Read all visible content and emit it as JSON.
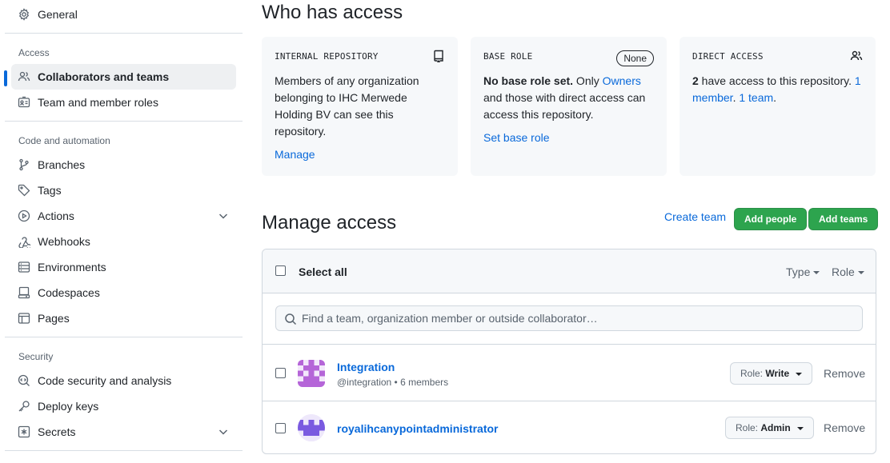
{
  "sidebar": {
    "general": "General",
    "sections": {
      "access": "Access",
      "code_automation": "Code and automation",
      "security": "Security"
    },
    "items": {
      "collaborators": "Collaborators and teams",
      "team_roles": "Team and member roles",
      "branches": "Branches",
      "tags": "Tags",
      "actions": "Actions",
      "webhooks": "Webhooks",
      "environments": "Environments",
      "codespaces": "Codespaces",
      "pages": "Pages",
      "code_security": "Code security and analysis",
      "deploy_keys": "Deploy keys",
      "secrets": "Secrets"
    }
  },
  "who_has_access": {
    "title": "Who has access",
    "internal": {
      "label": "INTERNAL REPOSITORY",
      "text": "Members of any organization belonging to IHC Merwede Holding BV can see this repository.",
      "link": "Manage"
    },
    "base_role": {
      "label": "BASE ROLE",
      "pill": "None",
      "bold": "No base role set.",
      "text1": " Only ",
      "owners": "Owners",
      "text2": " and those with direct access can access this repository.",
      "link": "Set base role"
    },
    "direct": {
      "label": "DIRECT ACCESS",
      "count": "2",
      "text": " have access to this repository. ",
      "member_link": "1 member",
      "sep": ". ",
      "team_link": "1 team",
      "end": "."
    }
  },
  "manage_access": {
    "title": "Manage access",
    "create_team": "Create team",
    "add_people": "Add people",
    "add_teams": "Add teams",
    "select_all": "Select all",
    "type_filter": "Type",
    "role_filter": "Role",
    "search_placeholder": "Find a team, organization member or outside collaborator…",
    "rows": [
      {
        "name": "Integration",
        "sub": "@integration • 6 members",
        "role_prefix": "Role: ",
        "role": "Write",
        "remove": "Remove"
      },
      {
        "name": "royalihcanypointadministrator",
        "role_prefix": "Role: ",
        "role": "Admin",
        "remove": "Remove"
      }
    ]
  },
  "colors": {
    "accent": "#0969da",
    "green": "#2da44e",
    "avatar_team": "#b565d8",
    "avatar_user": "#7a5ae0"
  }
}
